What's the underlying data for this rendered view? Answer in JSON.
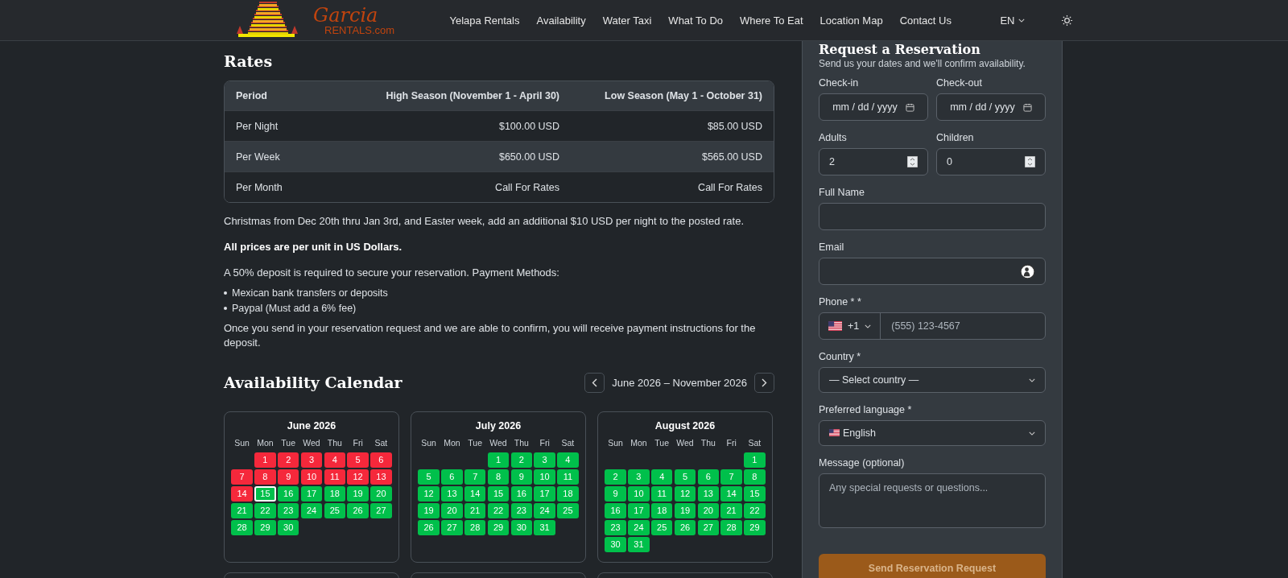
{
  "nav": {
    "logo": {
      "name": "Garcia",
      "sub": "RENTALS.com"
    },
    "links": [
      "Yelapa Rentals",
      "Availability",
      "Water Taxi",
      "What To Do",
      "Where To Eat",
      "Location Map",
      "Contact Us"
    ],
    "language": "EN"
  },
  "rates": {
    "title": "Rates",
    "columns": [
      "Period",
      "High Season (November 1 - April 30)",
      "Low Season (May 1 - October 31)"
    ],
    "rows": [
      {
        "cells": [
          "Per Night",
          "$100.00 USD",
          "$85.00 USD"
        ],
        "highlighted": false
      },
      {
        "cells": [
          "Per Week",
          "$650.00 USD",
          "$565.00 USD"
        ],
        "highlighted": true
      },
      {
        "cells": [
          "Per Month",
          "Call For Rates",
          "Call For Rates"
        ],
        "highlighted": false
      }
    ],
    "surcharge": "Christmas from Dec 20th thru Jan 3rd, and Easter week, add an additional $10 USD per night to the posted rate.",
    "currency_note": "All prices are per unit in US Dollars.",
    "deposit": "A 50% deposit is required to secure your reservation. Payment Methods:",
    "payment_methods": [
      "Mexican bank transfers or deposits",
      "Paypal (Must add a 6% fee)"
    ],
    "closing": "Once you send in your reservation request and we are able to confirm, you will receive payment instructions for the deposit."
  },
  "calendar": {
    "title": "Availability Calendar",
    "range": "June 2026 – November 2026",
    "months": [
      {
        "title": "June 2026",
        "weekdays": [
          "Sun",
          "Mon",
          "Tue",
          "Wed",
          "Thu",
          "Fri",
          "Sat"
        ],
        "weeks": [
          {
            "leading_gap": true,
            "days": [
              {
                "day": "1",
                "booked": true,
                "today": false
              },
              {
                "day": "2",
                "booked": true,
                "today": false
              },
              {
                "day": "3",
                "booked": true,
                "today": false
              },
              {
                "day": "4",
                "booked": true,
                "today": false
              },
              {
                "day": "5",
                "booked": true,
                "today": false
              },
              {
                "day": "6",
                "booked": true,
                "today": false
              }
            ]
          },
          {
            "days": [
              {
                "day": "7",
                "booked": true,
                "today": false
              },
              {
                "day": "8",
                "booked": true,
                "today": false
              },
              {
                "day": "9",
                "booked": true,
                "today": false
              },
              {
                "day": "10",
                "booked": true,
                "today": false
              },
              {
                "day": "11",
                "booked": true,
                "today": false
              },
              {
                "day": "12",
                "booked": true,
                "today": false
              },
              {
                "day": "13",
                "booked": true,
                "today": false
              }
            ]
          },
          {
            "days": [
              {
                "day": "14",
                "booked": true,
                "today": false
              },
              {
                "day": "15",
                "booked": false,
                "today": true
              },
              {
                "day": "16",
                "booked": false,
                "today": false
              },
              {
                "day": "17",
                "booked": false,
                "today": false
              },
              {
                "day": "18",
                "booked": false,
                "today": false
              },
              {
                "day": "19",
                "booked": false,
                "today": false
              },
              {
                "day": "20",
                "booked": false,
                "today": false
              }
            ]
          },
          {
            "days": [
              {
                "day": "21",
                "booked": false,
                "today": false
              },
              {
                "day": "22",
                "booked": false,
                "today": false
              },
              {
                "day": "23",
                "booked": false,
                "today": false
              },
              {
                "day": "24",
                "booked": false,
                "today": false
              },
              {
                "day": "25",
                "booked": false,
                "today": false
              },
              {
                "day": "26",
                "booked": false,
                "today": false
              },
              {
                "day": "27",
                "booked": false,
                "today": false
              }
            ]
          },
          {
            "leading_gap": false,
            "days": [
              {
                "day": "28",
                "booked": false,
                "today": false
              },
              {
                "day": "29",
                "booked": false,
                "today": false
              },
              {
                "day": "30",
                "booked": false,
                "today": false
              }
            ]
          }
        ]
      },
      {
        "title": "July 2026",
        "weekdays": [
          "Sun",
          "Mon",
          "Tue",
          "Wed",
          "Thu",
          "Fri",
          "Sat"
        ],
        "weeks": [
          {
            "leading_gap": true,
            "days": [
              {
                "day": "1",
                "booked": false,
                "today": false
              },
              {
                "day": "2",
                "booked": false,
                "today": false
              },
              {
                "day": "3",
                "booked": false,
                "today": false
              },
              {
                "day": "4",
                "booked": false,
                "today": false
              }
            ]
          },
          {
            "days": [
              {
                "day": "5",
                "booked": false,
                "today": false
              },
              {
                "day": "6",
                "booked": false,
                "today": false
              },
              {
                "day": "7",
                "booked": false,
                "today": false
              },
              {
                "day": "8",
                "booked": false,
                "today": false
              },
              {
                "day": "9",
                "booked": false,
                "today": false
              },
              {
                "day": "10",
                "booked": false,
                "today": false
              },
              {
                "day": "11",
                "booked": false,
                "today": false
              }
            ]
          },
          {
            "days": [
              {
                "day": "12",
                "booked": false,
                "today": false
              },
              {
                "day": "13",
                "booked": false,
                "today": false
              },
              {
                "day": "14",
                "booked": false,
                "today": false
              },
              {
                "day": "15",
                "booked": false,
                "today": false
              },
              {
                "day": "16",
                "booked": false,
                "today": false
              },
              {
                "day": "17",
                "booked": false,
                "today": false
              },
              {
                "day": "18",
                "booked": false,
                "today": false
              }
            ]
          },
          {
            "days": [
              {
                "day": "19",
                "booked": false,
                "today": false
              },
              {
                "day": "20",
                "booked": false,
                "today": false
              },
              {
                "day": "21",
                "booked": false,
                "today": false
              },
              {
                "day": "22",
                "booked": false,
                "today": false
              },
              {
                "day": "23",
                "booked": false,
                "today": false
              },
              {
                "day": "24",
                "booked": false,
                "today": false
              },
              {
                "day": "25",
                "booked": false,
                "today": false
              }
            ]
          },
          {
            "leading_gap": false,
            "days": [
              {
                "day": "26",
                "booked": false,
                "today": false
              },
              {
                "day": "27",
                "booked": false,
                "today": false
              },
              {
                "day": "28",
                "booked": false,
                "today": false
              },
              {
                "day": "29",
                "booked": false,
                "today": false
              },
              {
                "day": "30",
                "booked": false,
                "today": false
              },
              {
                "day": "31",
                "booked": false,
                "today": false
              }
            ]
          }
        ]
      },
      {
        "title": "August 2026",
        "weekdays": [
          "Sun",
          "Mon",
          "Tue",
          "Wed",
          "Thu",
          "Fri",
          "Sat"
        ],
        "weeks": [
          {
            "leading_gap": true,
            "days": [
              {
                "day": "1",
                "booked": false,
                "today": false
              }
            ]
          },
          {
            "days": [
              {
                "day": "2",
                "booked": false,
                "today": false
              },
              {
                "day": "3",
                "booked": false,
                "today": false
              },
              {
                "day": "4",
                "booked": false,
                "today": false
              },
              {
                "day": "5",
                "booked": false,
                "today": false
              },
              {
                "day": "6",
                "booked": false,
                "today": false
              },
              {
                "day": "7",
                "booked": false,
                "today": false
              },
              {
                "day": "8",
                "booked": false,
                "today": false
              }
            ]
          },
          {
            "days": [
              {
                "day": "9",
                "booked": false,
                "today": false
              },
              {
                "day": "10",
                "booked": false,
                "today": false
              },
              {
                "day": "11",
                "booked": false,
                "today": false
              },
              {
                "day": "12",
                "booked": false,
                "today": false
              },
              {
                "day": "13",
                "booked": false,
                "today": false
              },
              {
                "day": "14",
                "booked": false,
                "today": false
              },
              {
                "day": "15",
                "booked": false,
                "today": false
              }
            ]
          },
          {
            "days": [
              {
                "day": "16",
                "booked": false,
                "today": false
              },
              {
                "day": "17",
                "booked": false,
                "today": false
              },
              {
                "day": "18",
                "booked": false,
                "today": false
              },
              {
                "day": "19",
                "booked": false,
                "today": false
              },
              {
                "day": "20",
                "booked": false,
                "today": false
              },
              {
                "day": "21",
                "booked": false,
                "today": false
              },
              {
                "day": "22",
                "booked": false,
                "today": false
              }
            ]
          },
          {
            "days": [
              {
                "day": "23",
                "booked": false,
                "today": false
              },
              {
                "day": "24",
                "booked": false,
                "today": false
              },
              {
                "day": "25",
                "booked": false,
                "today": false
              },
              {
                "day": "26",
                "booked": false,
                "today": false
              },
              {
                "day": "27",
                "booked": false,
                "today": false
              },
              {
                "day": "28",
                "booked": false,
                "today": false
              },
              {
                "day": "29",
                "booked": false,
                "today": false
              }
            ]
          },
          {
            "days": [
              {
                "day": "30",
                "booked": false,
                "today": false
              },
              {
                "day": "31",
                "booked": false,
                "today": false
              }
            ]
          }
        ]
      }
    ]
  },
  "reservation": {
    "title": "Request a Reservation",
    "subtitle": "Send us your dates and we'll confirm availability.",
    "rows": [
      [
        {
          "kind": "date",
          "label": "Check-in",
          "placeholder": "mm / dd / yyyy"
        },
        {
          "kind": "date",
          "label": "Check-out",
          "placeholder": "mm / dd / yyyy"
        }
      ],
      [
        {
          "kind": "number",
          "label": "Adults",
          "value": "2"
        },
        {
          "kind": "number",
          "label": "Children",
          "value": "0"
        }
      ],
      [
        {
          "kind": "text",
          "label": "Full Name"
        }
      ],
      [
        {
          "kind": "email",
          "label": "Email"
        }
      ],
      [
        {
          "kind": "phone",
          "label": "Phone * *",
          "code": "+1",
          "placeholder": "(555) 123-4567"
        }
      ],
      [
        {
          "kind": "select",
          "label": "Country *",
          "value": "— Select country —"
        }
      ],
      [
        {
          "kind": "language",
          "label": "Preferred language *",
          "value": "English"
        }
      ],
      [
        {
          "kind": "textarea",
          "label": "Message (optional)",
          "placeholder": "Any special requests or questions..."
        }
      ]
    ],
    "submit": "Send Reservation Request"
  }
}
